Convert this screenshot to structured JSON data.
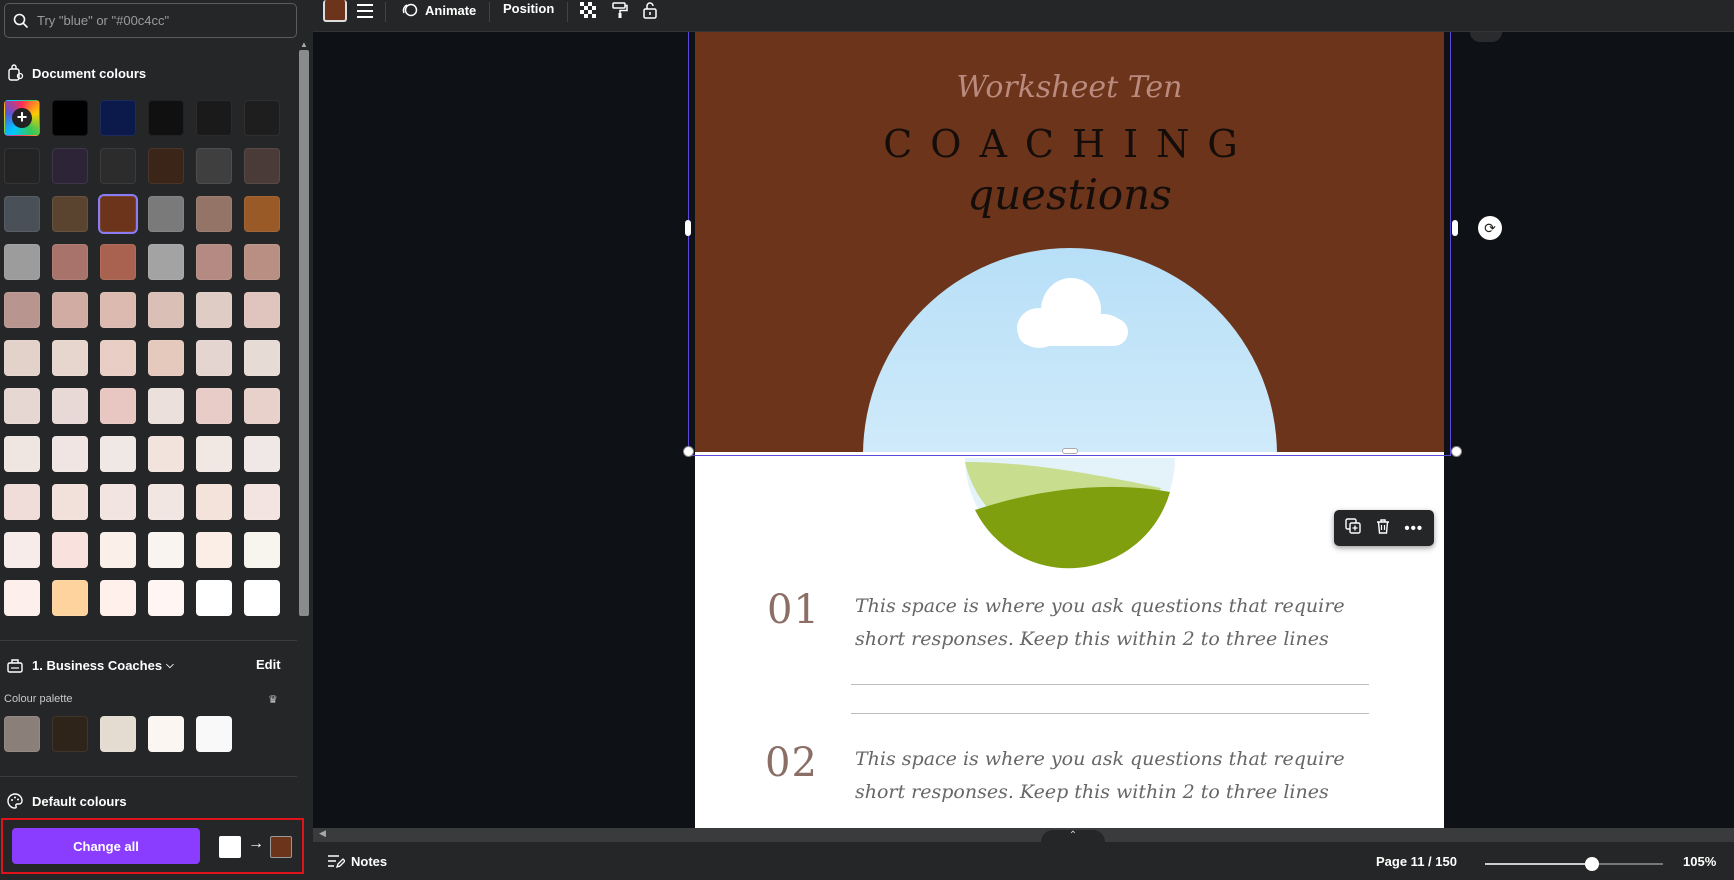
{
  "search": {
    "placeholder": "Try \"blue\" or \"#00c4cc\""
  },
  "document_colours": {
    "title": "Document colours",
    "swatches": [
      "add",
      "#000000",
      "#0b1a4a",
      "#101010",
      "#1a1a1a",
      "#1e1e1e",
      "#242424",
      "#2e2438",
      "#2c2c2c",
      "#3b2418",
      "#3f3f3f",
      "#4a3b38",
      "#4a5058",
      "#5a4430",
      "#6b341b",
      "#7a7a7a",
      "#957468",
      "#9a5a27",
      "#9c9c9c",
      "#a8736a",
      "#a9624f",
      "#a3a3a3",
      "#b58a82",
      "#b98f84",
      "#b99590",
      "#d1aca2",
      "#dcbab0",
      "#dabfb7",
      "#dfccc5",
      "#e0c4be",
      "#e3d2ca",
      "#e7d6ce",
      "#e8cec4",
      "#e6c9bd",
      "#e5d5d0",
      "#e7dbd6",
      "#e7d7d3",
      "#e8d8d6",
      "#e8c7c2",
      "#ebe0db",
      "#e8ccc8",
      "#e8d0cb",
      "#efe6e1",
      "#f0e5e2",
      "#efe8e4",
      "#f2e3dd",
      "#f1e8e4",
      "#f0e8e6",
      "#f0dcd8",
      "#f2e1db",
      "#f2e4e1",
      "#f2e6e3",
      "#f4e3da",
      "#f4e4e1",
      "#f7ecea",
      "#f9e1dd",
      "#faefe9",
      "#faf4f1",
      "#fbeee7",
      "#f8f5ef",
      "#fdefeb",
      "#ffd39e",
      "#fff0eb",
      "#fff5f2",
      "#ffffff",
      "#ffffff"
    ],
    "selected_index": 14
  },
  "brand_kit": {
    "title": "1. Business Coaches",
    "edit_label": "Edit",
    "palette_label": "Colour palette",
    "palette": [
      "#8b7f7a",
      "#2f2419",
      "#e4dbd1",
      "#fcf6f3",
      "#f9f9f9"
    ]
  },
  "default_colours": {
    "title": "Default colours"
  },
  "change_all": {
    "label": "Change all",
    "from_color": "#ffffff",
    "to_color": "#6b341b"
  },
  "toolbar": {
    "current_color": "#6b341b",
    "animate_label": "Animate",
    "position_label": "Position"
  },
  "page": {
    "bg_color": "#6b341b",
    "subtitle": "Worksheet Ten",
    "title": "COACHING",
    "script_title": "questions",
    "questions": [
      {
        "number": "01",
        "text": "This space is where you ask questions that require short responses. Keep this within 2 to three lines"
      },
      {
        "number": "02",
        "text": "This space is where you ask questions that require short responses. Keep this within 2 to three lines"
      }
    ]
  },
  "bottombar": {
    "notes_label": "Notes",
    "page_indicator": "Page 11 / 150",
    "zoom_label": "105%",
    "zoom_fraction": 0.6
  }
}
